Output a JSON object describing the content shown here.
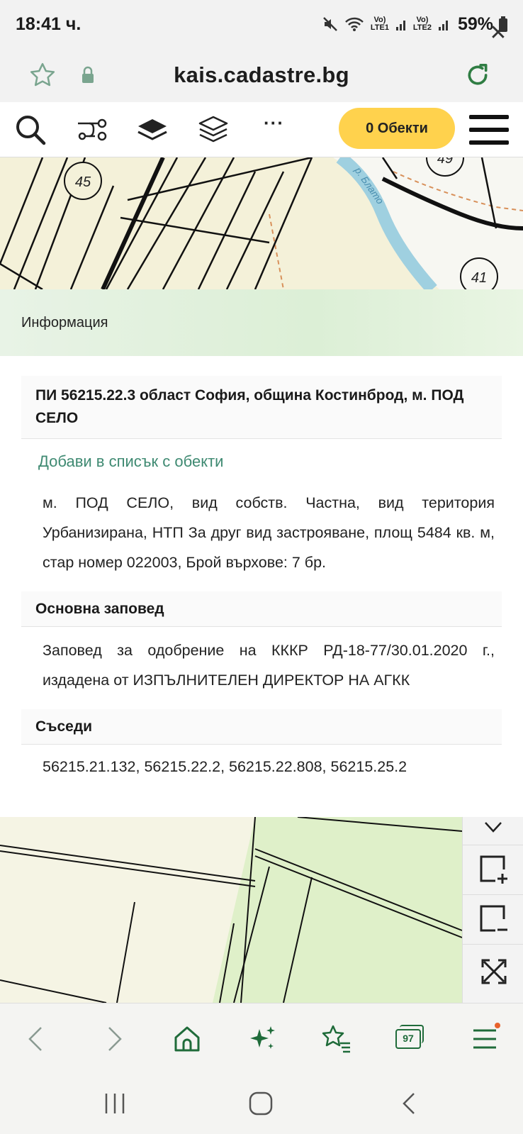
{
  "status": {
    "time": "18:41 ч.",
    "lte1": "Vo) LTE1",
    "lte2": "Vo) LTE2",
    "battery": "59%"
  },
  "browser": {
    "url": "kais.cadastre.bg",
    "tab_count": "97"
  },
  "toolbar": {
    "objects_button": "0 Обекти",
    "more_label": "···"
  },
  "map": {
    "labels": [
      "45",
      "49",
      "41",
      "р. Блато"
    ]
  },
  "panel": {
    "title": "Информация",
    "parcel_heading": "ПИ 56215.22.3 област София, община Костинброд, м. ПОД СЕЛО",
    "add_link": "Добави в списък с обекти",
    "description": "м. ПОД СЕЛО, вид собств. Частна, вид територия Урбанизирана, НТП За друг вид застрояване, площ 5484 кв. м, стар номер 022003, Брой върхове: 7 бр.",
    "order_title": "Основна заповед",
    "order_text": "Заповед за одобрение на КККР РД-18-77/30.01.2020 г., издадена от ИЗПЪЛНИТЕЛЕН ДИРЕКТОР НА АГКК",
    "neighbours_title": "Съседи",
    "neighbours_text": "56215.21.132, 56215.22.2, 56215.22.808, 56215.25.2"
  },
  "colors": {
    "accent_green": "#3f8a72",
    "objects_yellow": "#ffd24d",
    "river_blue": "#9fd0e0"
  }
}
